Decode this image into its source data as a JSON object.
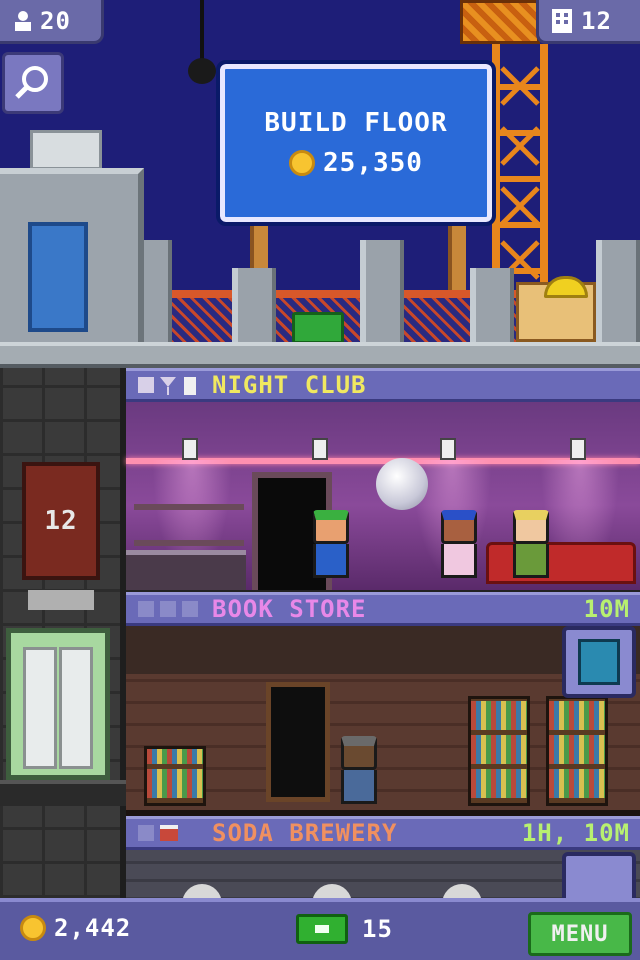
{
  "hud": {
    "population": "20",
    "floors": "12"
  },
  "build_sign": {
    "title": "BUILD FLOOR",
    "cost": "25,350"
  },
  "elevator": {
    "floor_number": "12"
  },
  "floors": {
    "nightclub": {
      "name": "NIGHT CLUB",
      "timer": ""
    },
    "bookstore": {
      "name": "BOOK STORE",
      "timer": "10M"
    },
    "soda": {
      "name": "SODA BREWERY",
      "timer": "1H, 10M"
    }
  },
  "bottom_bar": {
    "coins": "2,442",
    "bux": "15",
    "menu_label": "MENU"
  },
  "colors": {
    "sky": "#1e1e78",
    "banner": "#6a6ab8",
    "menu_green": "#48b848",
    "coin_gold": "#f8c430"
  },
  "icons": {
    "population": "person-icon",
    "floors": "building-icon",
    "search": "magnifier-icon",
    "coin": "coin-icon",
    "bux": "tower-bux-icon"
  }
}
